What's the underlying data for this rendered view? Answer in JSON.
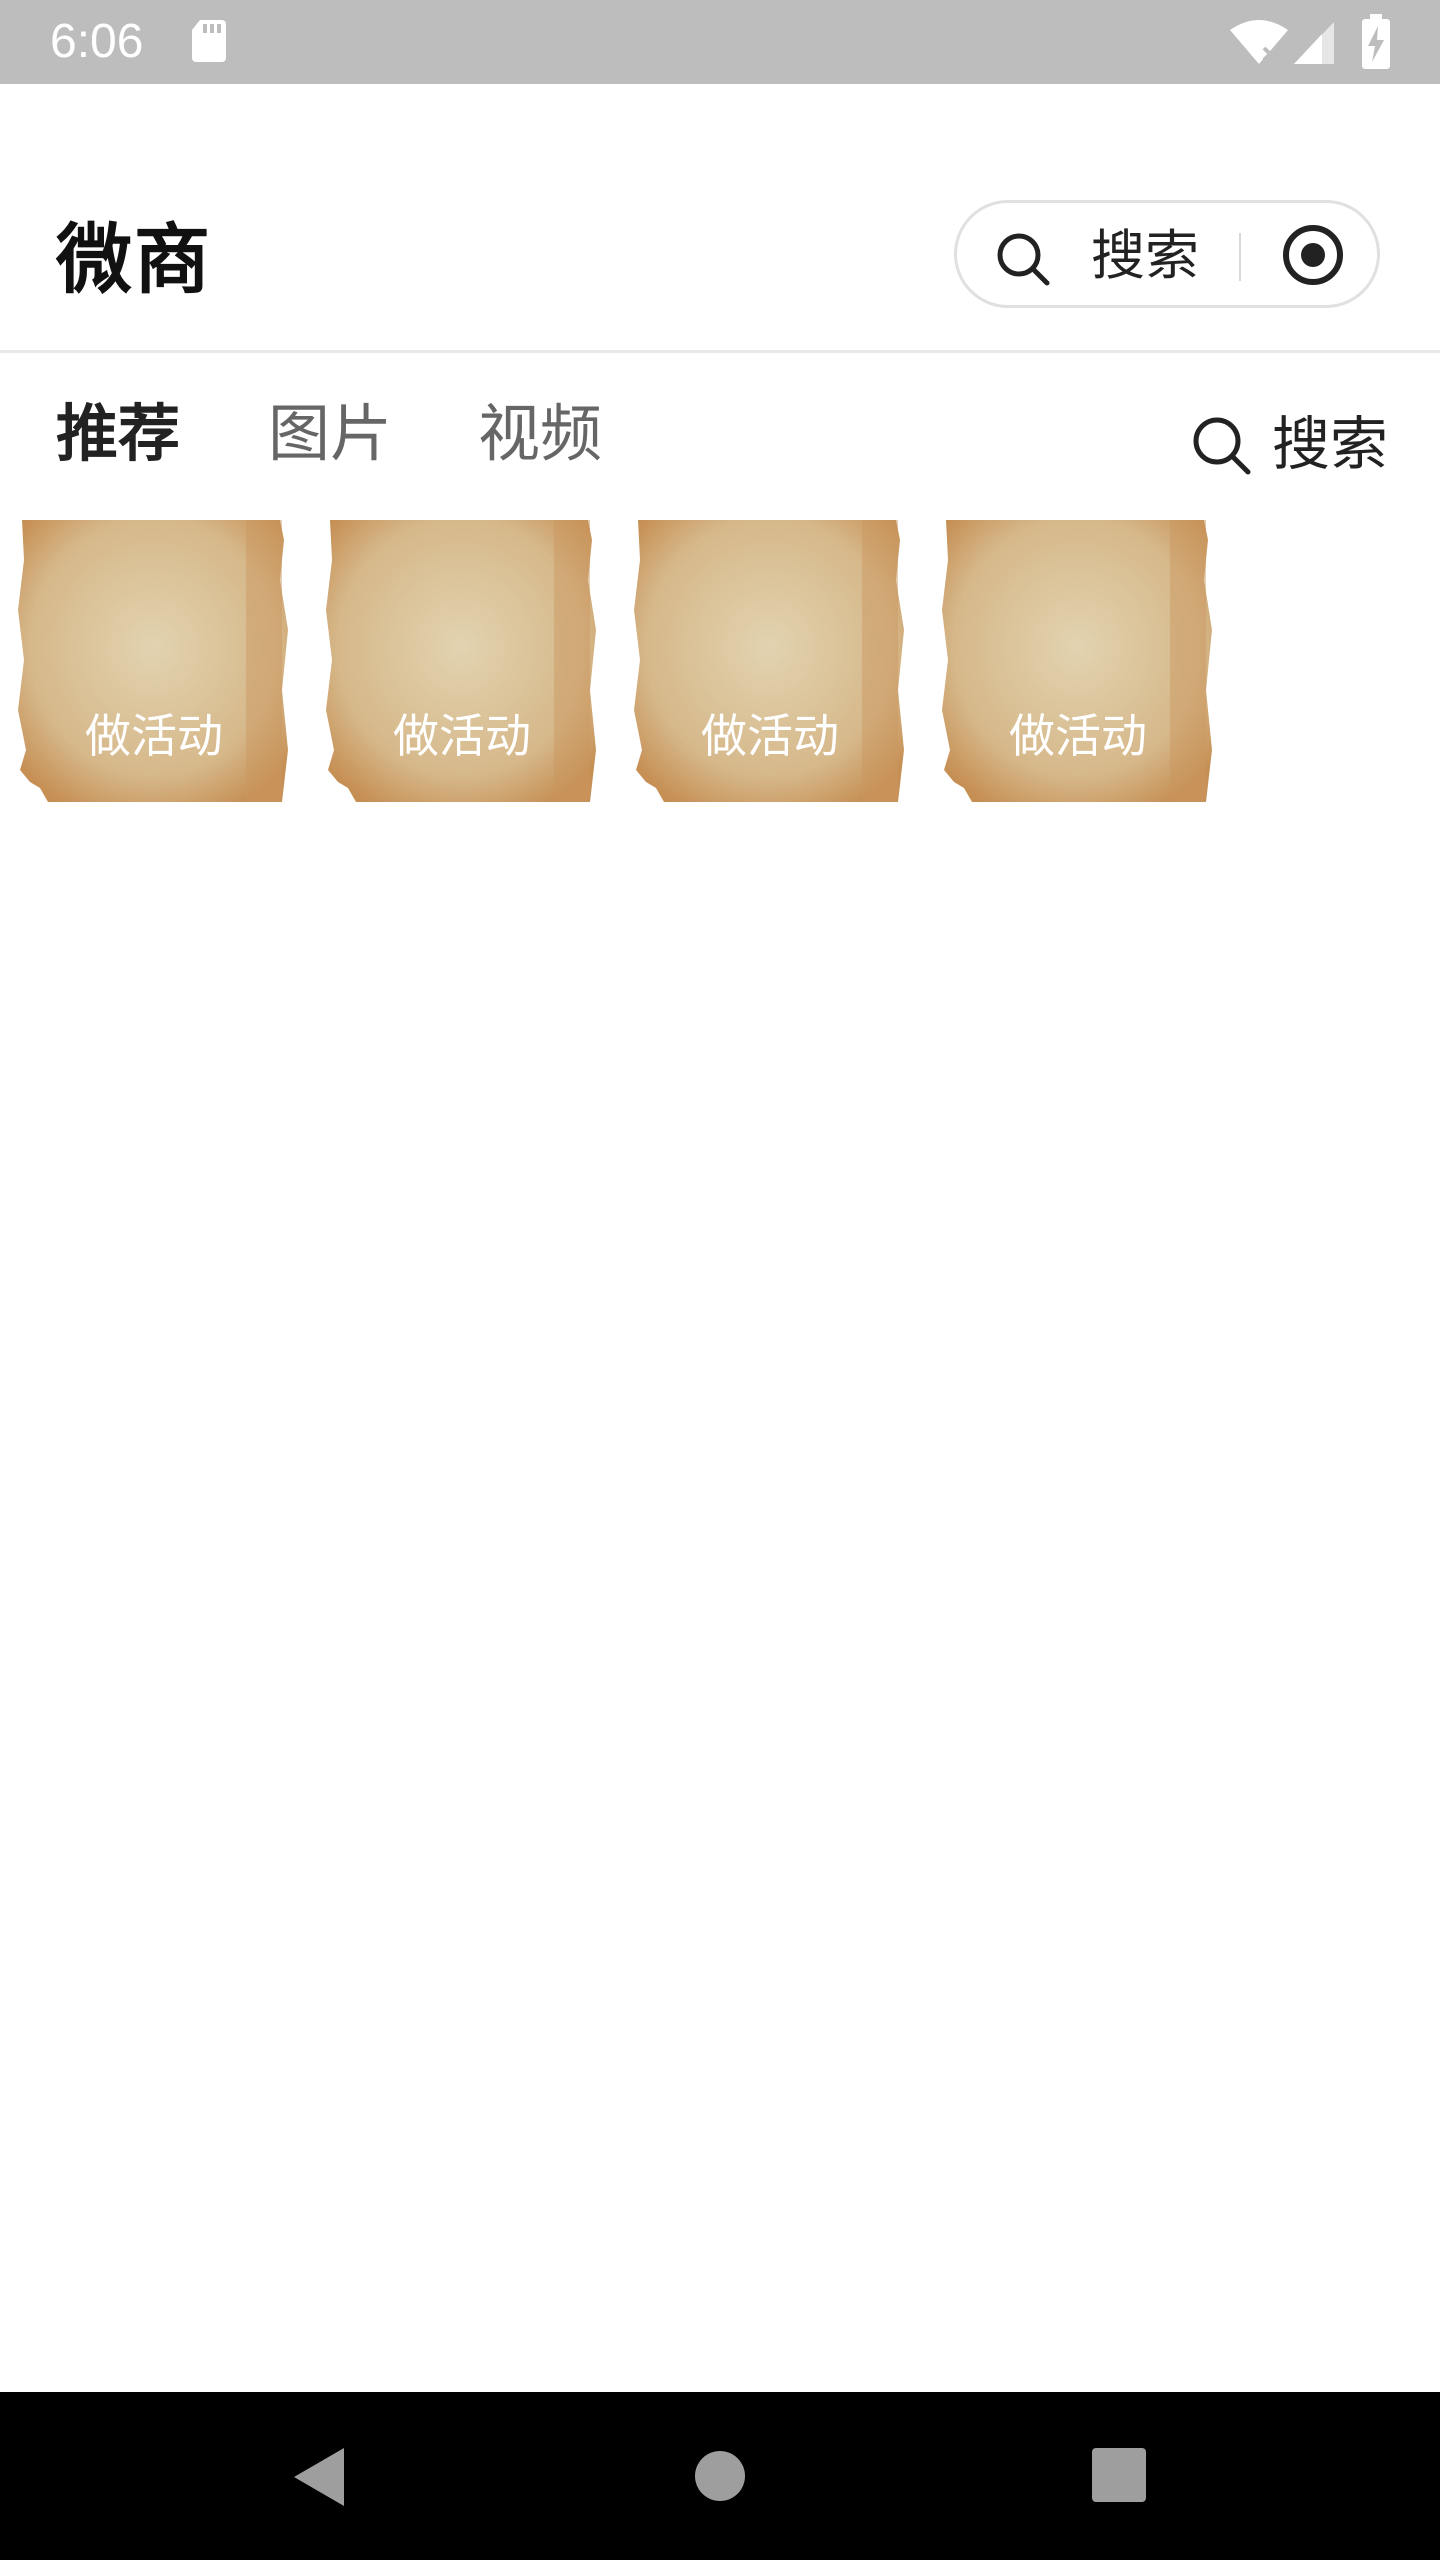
{
  "status_bar": {
    "time": "6:06",
    "icons": [
      "sd-card-icon",
      "wifi-off-icon",
      "signal-icon",
      "battery-charging-icon"
    ]
  },
  "header": {
    "title": "微商",
    "capsule": {
      "search_label": "搜索",
      "icons": [
        "search-icon",
        "target-icon"
      ]
    }
  },
  "tabs": {
    "items": [
      {
        "label": "推荐",
        "active": true
      },
      {
        "label": "图片",
        "active": false
      },
      {
        "label": "视频",
        "active": false
      }
    ],
    "search_label": "搜索"
  },
  "cards": [
    {
      "label": "做活动"
    },
    {
      "label": "做活动"
    },
    {
      "label": "做活动"
    },
    {
      "label": "做活动"
    }
  ],
  "nav_bar": {
    "icons": [
      "back-icon",
      "home-icon",
      "recents-icon"
    ]
  },
  "colors": {
    "status_bar": "#bdbdbd",
    "nav_bar": "#000000",
    "paper_center": "#dcc8a0",
    "paper_edge": "#c9955a"
  }
}
